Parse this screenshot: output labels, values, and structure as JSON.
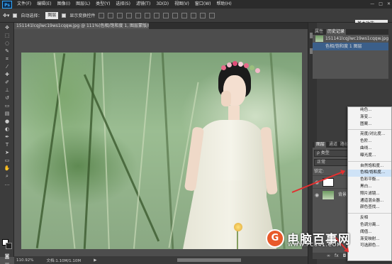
{
  "app": {
    "logo": "Ps"
  },
  "menu": [
    "文件(F)",
    "编辑(E)",
    "图像(I)",
    "图层(L)",
    "类型(Y)",
    "选择(S)",
    "滤镜(T)",
    "3D(D)",
    "视图(V)",
    "窗口(W)",
    "帮助(H)"
  ],
  "window_buttons": [
    "—",
    "□",
    "✕"
  ],
  "options_bar": {
    "auto_select": "自动选择：",
    "auto_select_value": "图层",
    "transform_controls": "显示变换控件",
    "workspace": "基本功能"
  },
  "document": {
    "tab_title": "151141lcqjlwc19ws1cqqw.jpg @ 111%(色相/饱和度 1, 图层蒙版/8) *"
  },
  "status": {
    "zoom": "110.92%",
    "doc_info": "文档:1.10M/1.10M"
  },
  "history_panel": {
    "tabs": [
      "属性",
      "历史记录"
    ],
    "rows": [
      "151141lcqjlwc19ws1cqqw.jpg",
      "色相/饱和度 1 图层"
    ]
  },
  "layers_panel": {
    "tabs": [
      "图层",
      "通道",
      "路径"
    ],
    "kind_filter": "ρ 类型",
    "blend_mode": "正常",
    "lock_label": "锁定:",
    "layers": [
      {
        "name": "",
        "type": "adjustment"
      },
      {
        "name": "背景",
        "type": "background"
      }
    ]
  },
  "adjustment_menu": {
    "items": [
      "纯色...",
      "渐变...",
      "图案...",
      "",
      "亮度/对比度...",
      "色阶...",
      "曲线...",
      "曝光度...",
      "",
      "自然饱和度...",
      "色相/饱和度...",
      "色彩平衡...",
      "黑白...",
      "照片滤镜...",
      "通道混合器...",
      "颜色查找...",
      "",
      "反相",
      "色调分离...",
      "阈值...",
      "渐变映射...",
      "可选颜色..."
    ],
    "highlighted": "色相/饱和度..."
  },
  "watermark": {
    "logo": "G",
    "title": "电脑百事网",
    "url": "WWW.PC841.COM"
  },
  "colors": {
    "accent": "#31a8ff",
    "annotation_arrow": "#e23030",
    "selection": "#3b5f8a"
  }
}
